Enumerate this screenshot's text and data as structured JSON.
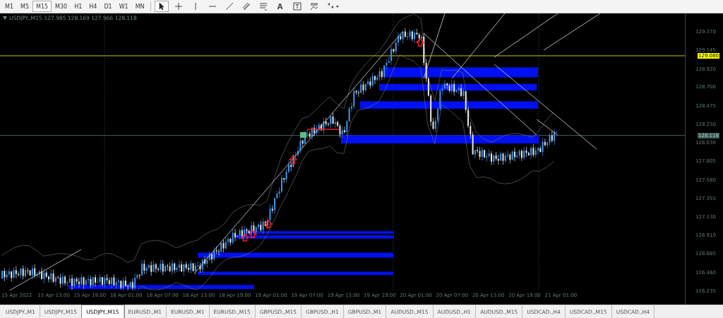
{
  "toolbar": {
    "timeframes": [
      {
        "label": "M1",
        "selected": false
      },
      {
        "label": "M5",
        "selected": false
      },
      {
        "label": "M15",
        "selected": true
      },
      {
        "label": "M30",
        "selected": false
      },
      {
        "label": "H1",
        "selected": false
      },
      {
        "label": "H4",
        "selected": false
      },
      {
        "label": "D1",
        "selected": false
      },
      {
        "label": "W1",
        "selected": false
      },
      {
        "label": "MN",
        "selected": false
      }
    ],
    "tools": [
      {
        "kind": "cursor",
        "selected": true
      },
      {
        "kind": "crosshair",
        "selected": false
      },
      {
        "kind": "vline",
        "selected": false
      },
      {
        "kind": "hline",
        "selected": false
      },
      {
        "kind": "trendline",
        "selected": false
      },
      {
        "kind": "channel",
        "selected": false
      },
      {
        "kind": "fibo",
        "selected": false
      },
      {
        "kind": "text",
        "label": "A",
        "selected": false
      },
      {
        "kind": "label",
        "selected": false
      },
      {
        "kind": "fibfan",
        "selected": false
      },
      {
        "kind": "arrows",
        "selected": false
      }
    ]
  },
  "chart": {
    "header": {
      "symbol": "USDJPY.,M15",
      "values": "127.985 128.169 127.966 128.118"
    },
    "price_ticks": [
      "129.370",
      "129.145",
      "128.920",
      "128.700",
      "128.475",
      "128.250",
      "128.030",
      "127.805",
      "127.580",
      "127.355",
      "127.130",
      "126.910",
      "126.685",
      "126.460",
      "126.235"
    ],
    "price_badges": [
      {
        "kind": "level",
        "text": "129.080"
      },
      {
        "kind": "bid",
        "text": "128.118"
      }
    ],
    "time_ticks": [
      "15 Apr 2022",
      "15 Apr 13:00",
      "15 Apr 19:00",
      "18 Apr 01:00",
      "18 Apr 07:00",
      "18 Apr 13:00",
      "18 Apr 19:00",
      "19 Apr 01:00",
      "19 Apr 07:00",
      "19 Apr 13:00",
      "19 Apr 19:00",
      "20 Apr 01:00",
      "20 Apr 07:00",
      "20 Apr 13:00",
      "20 Apr 19:00",
      "21 Apr 01:00"
    ]
  },
  "tabs": [
    {
      "label": "USDJPY.,M1",
      "selected": false
    },
    {
      "label": "USDJPY.,M15",
      "selected": false
    },
    {
      "label": "USDJPY.,M15",
      "selected": true
    },
    {
      "label": "EURUSD.,M1",
      "selected": false
    },
    {
      "label": "EURUSD.,M1",
      "selected": false
    },
    {
      "label": "EURUSD.,M15",
      "selected": false
    },
    {
      "label": "GBPUSD.,M15",
      "selected": false
    },
    {
      "label": "GBPUSD.,H1",
      "selected": false
    },
    {
      "label": "GBPUSD.,M1",
      "selected": false
    },
    {
      "label": "AUDUSD.,M15",
      "selected": false
    },
    {
      "label": "AUDUSD.,H1",
      "selected": false
    },
    {
      "label": "AUDUSD.,M15",
      "selected": false
    },
    {
      "label": "USDCAD.,H4",
      "selected": false
    },
    {
      "label": "USDCAD.,M15",
      "selected": false
    },
    {
      "label": "USDCAD.,H4",
      "selected": false
    }
  ]
}
